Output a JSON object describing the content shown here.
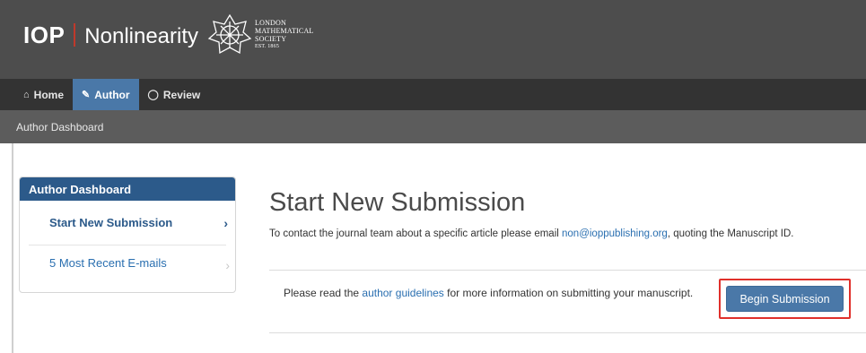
{
  "header": {
    "brand_iop": "IOP",
    "brand_name": "Nonlinearity",
    "society_logo": {
      "line1": "LONDON",
      "line2": "MATHEMATICAL",
      "line3": "SOCIETY",
      "line4": "EST. 1865",
      "icon": "lms-emblem-icon"
    }
  },
  "nav": {
    "items": [
      {
        "label": "Home",
        "icon": "home-icon"
      },
      {
        "label": "Author",
        "icon": "pencil-icon",
        "active": true
      },
      {
        "label": "Review",
        "icon": "speech-bubble-icon"
      }
    ]
  },
  "subbar": {
    "label": "Author Dashboard"
  },
  "sidebar": {
    "title": "Author Dashboard",
    "items": [
      {
        "label": "Start New Submission",
        "icon": "chevron-right-icon"
      },
      {
        "label": "5 Most Recent E-mails",
        "icon": "chevron-right-icon"
      }
    ]
  },
  "main": {
    "title": "Start New Submission",
    "contact_prefix": "To contact the journal team about a specific article please email ",
    "contact_email": "non@ioppublishing.org",
    "contact_suffix": ", quoting the Manuscript ID.",
    "guide_prefix": "Please read the ",
    "guide_link": "author guidelines",
    "guide_suffix": " for more information on submitting your manuscript.",
    "begin_button": "Begin Submission"
  },
  "colors": {
    "header_bg": "#4d4d4d",
    "nav_bg": "#333333",
    "active_tab": "#4a78a8",
    "sidebar_head": "#2c5a8a",
    "link": "#2a6fb0",
    "highlight": "#e0302b"
  }
}
